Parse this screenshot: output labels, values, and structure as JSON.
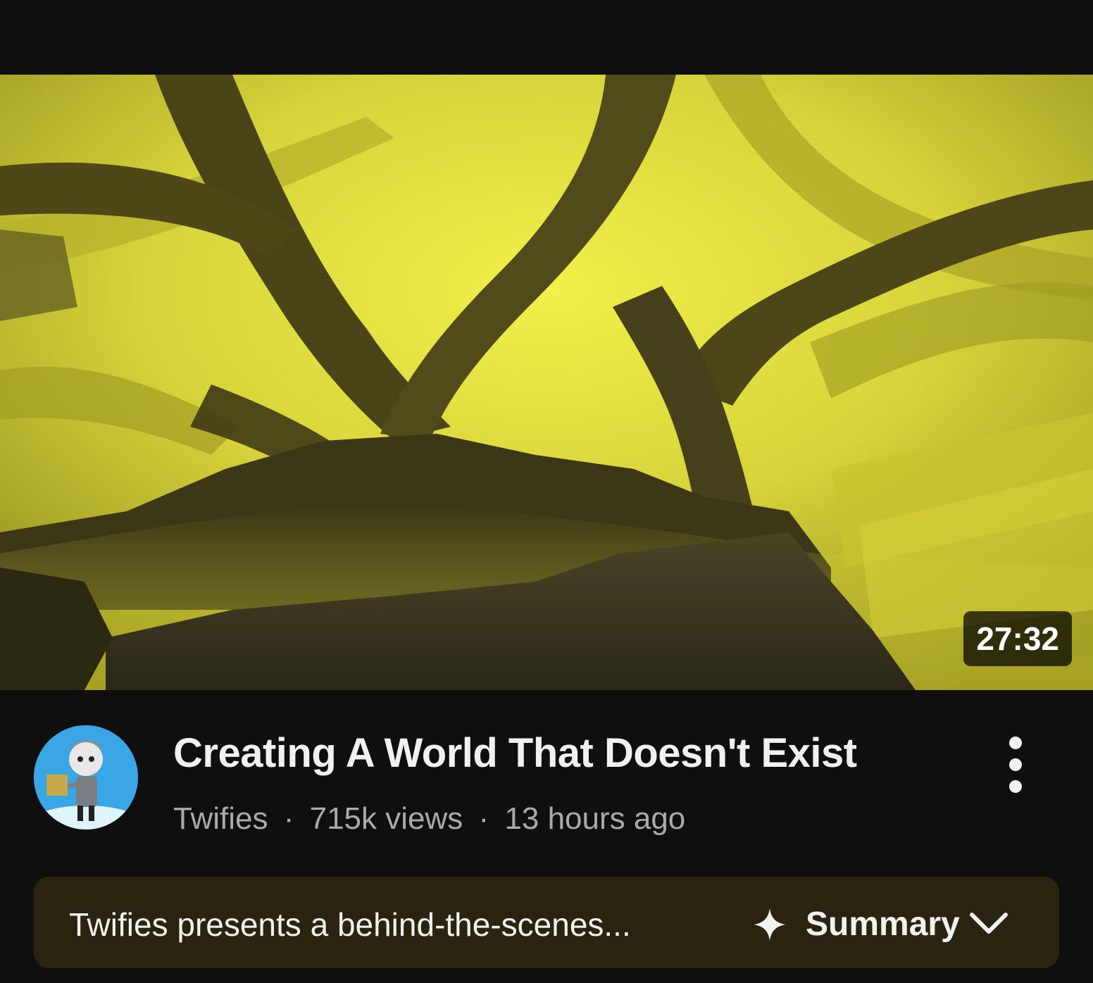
{
  "video": {
    "duration": "27:32",
    "title": "Creating A World That Doesn't Exist",
    "channel": "Twifies",
    "separator": "·",
    "views": "715k views",
    "age": "13 hours ago"
  },
  "summary": {
    "text": "Twifies presents a behind-the-scenes...",
    "label": "Summary"
  },
  "icons": {
    "more": "more-vertical-icon",
    "sparkle": "sparkle-icon",
    "chevron": "chevron-down-icon"
  },
  "colors": {
    "background": "#0f0f0f",
    "thumbnail_yellow": "#d8d43a",
    "summary_bg": "#2a2310",
    "secondary_text": "#aaaaaa"
  }
}
